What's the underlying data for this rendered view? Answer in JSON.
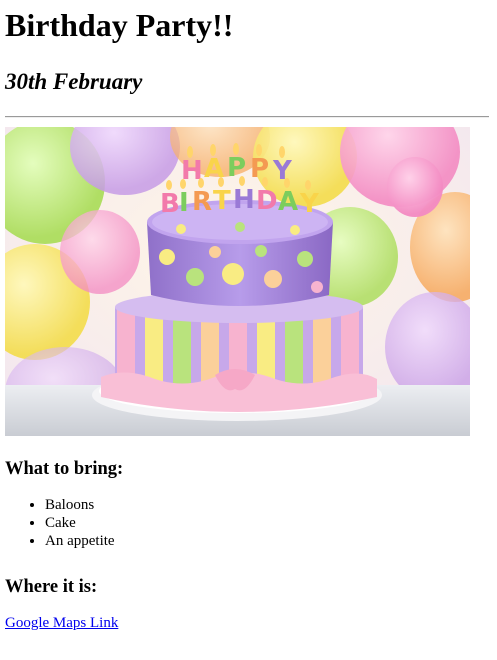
{
  "page": {
    "title": "Birthday Party!!",
    "date": "30th February"
  },
  "hero_image": {
    "cake_candles_text": "HAPPY BIRTHDAY"
  },
  "bring": {
    "heading": "What to bring:",
    "items": [
      "Baloons",
      "Cake",
      "An appetite"
    ]
  },
  "location": {
    "heading": "Where it is:",
    "link_label": "Google Maps Link"
  },
  "colors": {
    "link": "#0000ee",
    "rule": "#9a9a9a"
  }
}
